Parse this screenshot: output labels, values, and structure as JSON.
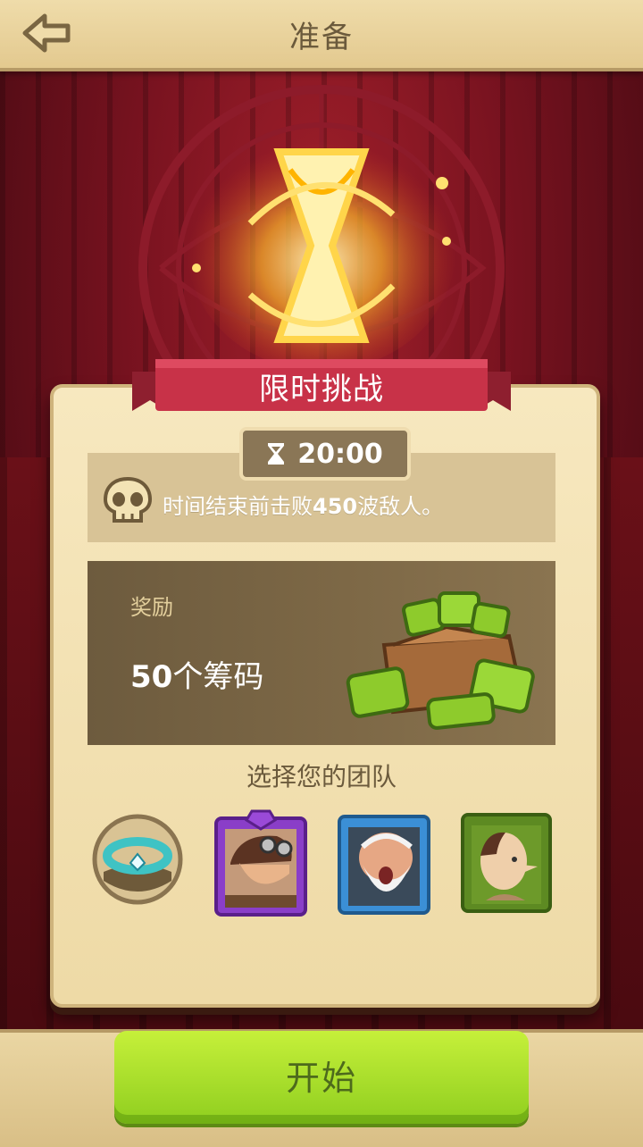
{
  "header": {
    "title": "准备",
    "back_icon": "back-arrow-icon"
  },
  "challenge": {
    "banner_title": "限时挑战",
    "timer_icon": "hourglass-icon",
    "timer_value": "20:00",
    "objective_icon": "skull-icon",
    "objective_prefix": "时间结束前击败",
    "objective_count": "450",
    "objective_suffix": "波敌人。"
  },
  "reward": {
    "label": "奖励",
    "amount": "50",
    "unit_text": "个筹码",
    "icon": "green-gem-bag-icon"
  },
  "team": {
    "title": "选择您的团队",
    "slots": [
      {
        "kind": "artifact",
        "icon": "teal-ring-icon",
        "frame_color": "#cdb07a"
      },
      {
        "kind": "hero",
        "icon": "goggles-hero-portrait",
        "frame_color": "#8a3ec8"
      },
      {
        "kind": "hero",
        "icon": "bearded-elder-portrait",
        "frame_color": "#3b8fd6"
      },
      {
        "kind": "hero",
        "icon": "bald-villager-portrait",
        "frame_color": "#5d8a22"
      }
    ]
  },
  "actions": {
    "start_label": "开始"
  },
  "colors": {
    "accent_green": "#a6dd2a",
    "banner_red": "#c83248",
    "parchment": "#f3e3b5"
  }
}
